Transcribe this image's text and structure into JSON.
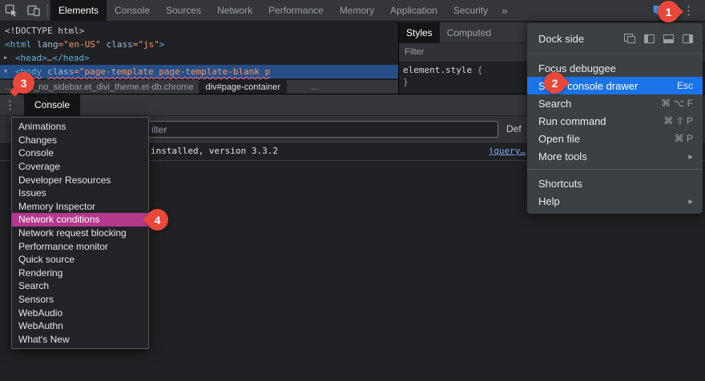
{
  "toolbar": {
    "tabs": [
      "Elements",
      "Console",
      "Sources",
      "Network",
      "Performance",
      "Memory",
      "Application",
      "Security"
    ],
    "active_tab": "Elements",
    "more_tabs": "»",
    "drawer_hint_count": "1",
    "menu_icon": "⋮"
  },
  "elements_panel": {
    "line1": "<!DOCTYPE html>",
    "line2": {
      "open": "<html",
      "attr1": "lang",
      "val1": "=\"en-US\"",
      "attr2": "class",
      "val2": "=\"js\"",
      "close": ">"
    },
    "line3": {
      "arrow": "▶",
      "open": "<head>",
      "dots": "…",
      "close": "</head>"
    },
    "line4": {
      "arrow": "▼",
      "open": "<body",
      "attr1": "class",
      "val1": "=\"page-template page-template-blank p"
    },
    "breadcrumb": {
      "left_more": "…",
      "parent": "ll.et_no_sidebar.et_divi_theme.et-db.chrome",
      "selected": "div#page-container",
      "right_more": "…"
    }
  },
  "styles_panel": {
    "tabs": [
      "Styles",
      "Computed"
    ],
    "filter_label": "Filter",
    "selector": "element.style",
    "open_brace": "{",
    "close_brace": "}"
  },
  "main_menu": {
    "items": [
      {
        "label": "Dock side"
      },
      {
        "label": "Focus debuggee"
      },
      {
        "label": "Show console drawer",
        "shortcut": "Esc"
      },
      {
        "label": "Search",
        "shortcut": "⌘ ⌥ F"
      },
      {
        "label": "Run command",
        "shortcut": "⌘ ⇧ P"
      },
      {
        "label": "Open file",
        "shortcut": "⌘ P"
      },
      {
        "label": "More tools",
        "arrow": "▸"
      },
      {
        "label": "Shortcuts"
      },
      {
        "label": "Help",
        "arrow": "▸"
      }
    ],
    "highlighted_item": "Show console drawer"
  },
  "drawer": {
    "menu_icon": "⋮",
    "tab_label": "Console",
    "panel_menu": [
      "Animations",
      "Changes",
      "Console",
      "Coverage",
      "Developer Resources",
      "Issues",
      "Memory Inspector",
      "Network conditions",
      "Network request blocking",
      "Performance monitor",
      "Quick source",
      "Rendering",
      "Search",
      "Sensors",
      "WebAudio",
      "WebAuthn",
      "What's New"
    ],
    "highlighted_item": "Network conditions"
  },
  "console": {
    "filter_partial": "ilter",
    "levels_partial": "Def",
    "message": "installed, version 3.3.2",
    "source_link": "jquery…"
  },
  "callouts": {
    "step1": "1",
    "step2": "2",
    "step3": "3",
    "step4": "4"
  },
  "colors": {
    "callout_red": "#e8473a",
    "menu_highlight_blue": "#1a73e8",
    "drawer_highlight_magenta": "#b4388c",
    "selected_node_blue": "#274f87",
    "link_blue": "#7cacf8"
  }
}
